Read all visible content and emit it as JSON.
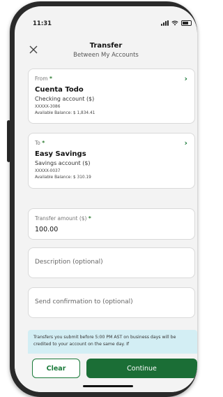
{
  "status": {
    "time": "11:31"
  },
  "header": {
    "title": "Transfer",
    "subtitle": "Between My Accounts"
  },
  "from": {
    "label": "From",
    "required_mark": "*",
    "account_name": "Cuenta Todo",
    "account_type": "Checking account ($)",
    "account_number": "XXXXX-3086",
    "balance": "Available Balance: $ 1,834.41"
  },
  "to": {
    "label": "To",
    "required_mark": "*",
    "account_name": "Easy Savings",
    "account_type": "Savings account ($)",
    "account_number": "XXXXX-0037",
    "balance": "Available Balance: $ 310.19"
  },
  "amount": {
    "label": "Transfer amount ($)",
    "required_mark": "*",
    "value": "100.00"
  },
  "description": {
    "placeholder": "Description (optional)"
  },
  "confirmation": {
    "placeholder": "Send confirmation to (optional)"
  },
  "info": {
    "text": "Transfers you submit before 5:00 PM AST on business days will be credited to your account on the same day. If"
  },
  "buttons": {
    "clear": "Clear",
    "continue": "Continue"
  },
  "colors": {
    "brand_green": "#1b6e36",
    "accent_green": "#1b7a3a",
    "info_bg": "#d3eef4"
  },
  "icons": {
    "close": "close-icon",
    "chevron": "chevron-right-icon"
  }
}
